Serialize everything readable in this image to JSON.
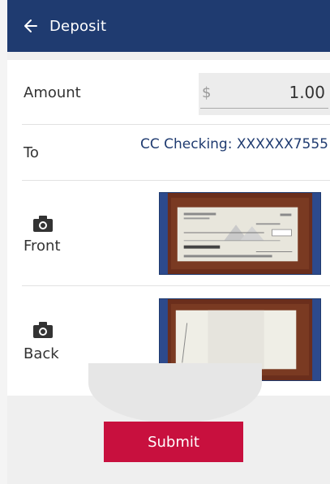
{
  "header": {
    "title": "Deposit",
    "back_icon": "arrow-left-icon"
  },
  "amount": {
    "label": "Amount",
    "currency_symbol": "$",
    "value": "1.00"
  },
  "to": {
    "label": "To",
    "account": "CC Checking: XXXXXX7555"
  },
  "front": {
    "label": "Front",
    "icon": "camera-icon"
  },
  "back": {
    "label": "Back",
    "icon": "camera-icon"
  },
  "submit": {
    "label": "Submit"
  },
  "colors": {
    "header": "#1f3b70",
    "submit": "#c8103e",
    "account_text": "#1f3b70",
    "thumb_bg": "#2d4a8c"
  }
}
